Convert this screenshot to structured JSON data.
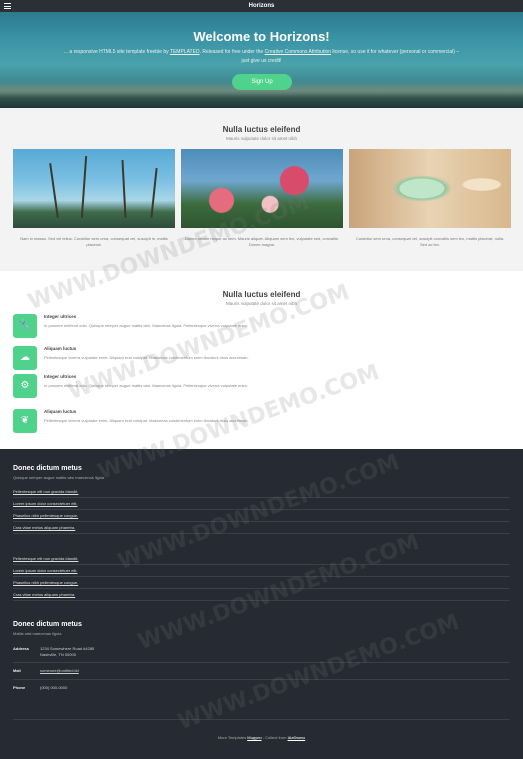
{
  "window": {
    "title": "Horizons"
  },
  "hero": {
    "heading": "Welcome to Horizons!",
    "text_a": "... a responsive HTML5 site template freebie by ",
    "link_templated": "TEMPLATED",
    "text_b": ". Released for free under the ",
    "link_license": "Creative Commons Attribution",
    "text_c": " license, so use it for whatever (personal or commercial) – just give us credit!",
    "signup_label": "Sign Up"
  },
  "section1": {
    "title": "Nulla luctus eleifend",
    "subtitle": "Mauris vulputate dolor sit amet nibh",
    "cards": [
      {
        "image": "palm-trees-photo",
        "text": "Nam in massa. Sed vel tellus. Curabitur sem urna, consequat vel, suscipit in, mattis placerat."
      },
      {
        "image": "pink-flowers-photo",
        "text": "Donec ornare neque ac sem. Mauris aliquet. Aliquam sem leo, vulputate sed, convallis. Donec magna."
      },
      {
        "image": "glass-jar-photo",
        "text": "Curabitur sem urna, consequat vel, suscipit convallis sem leo, mattis placerat, nulla. Sed ac leo."
      }
    ]
  },
  "section2": {
    "title": "Nulla luctus eleifend",
    "subtitle": "Mauris vulputate dolor sit amet nibh",
    "features": [
      {
        "icon": "wrench-icon",
        "glyph": "🔧",
        "title": "Integer ultrices",
        "text": "In posuere eleifend odio. Quisque semper augue mattis wisi. Maecenas ligula. Pellentesque viverra vulputate enim."
      },
      {
        "icon": "cloud-icon",
        "glyph": "☁",
        "title": "Aliquam luctus",
        "text": "Pellentesque viverra vulputate enim. Aliquam erat volutpat. Maecenas condimentum enim tincidunt risus accumsan."
      },
      {
        "icon": "gears-icon",
        "glyph": "⚙",
        "title": "Integer ultrices",
        "text": "In posuere eleifend odio. Quisque semper augue mattis wisi. Maecenas ligula. Pellentesque viverra vulputate enim."
      },
      {
        "icon": "leaf-icon",
        "glyph": "❦",
        "title": "Aliquam luctus",
        "text": "Pellentesque viverra vulputate enim. Aliquam erat volutpat. Maecenas condimentum enim tincidunt risus accumsan."
      }
    ]
  },
  "footer": {
    "links_title": "Donec dictum metus",
    "links_subtitle": "Quisque semper augue mattis wisi maecenas ligula",
    "links_group_1": [
      "Pellentesque elit non gravida blandit.",
      "Lorem ipsum dolor consectetuer elit.",
      "Phasellus nibh pellentesque congue.",
      "Cras vitae metus aliquam pharetra."
    ],
    "links_group_2": [
      "Pellentesque elit non gravida blandit.",
      "Lorem ipsum dolor consectetuer elit.",
      "Phasellus nibh pellentesque congue.",
      "Cras vitae metus aliquam pharetra."
    ],
    "contact_title": "Donec dictum metus",
    "contact_subtitle": "Mattis wisi maecenas ligula",
    "address_label": "Address",
    "address_line1": "1234 Somewhere Road #4285",
    "address_line2": "Nashville, TN 00000",
    "mail_label": "Mail",
    "mail_value": "someone@untitled.tld",
    "phone_label": "Phone",
    "phone_value": "(000) 000-0000",
    "copyright_prefix": "More Templates ",
    "copyright_link1": "Модули",
    "copyright_mid": " - Collect from ",
    "copyright_link2": "Шаблоны"
  },
  "watermark": "WWW.DOWNDEMO.COM",
  "colors": {
    "accent": "#4fd28b",
    "footer_bg": "#262a33",
    "topbar_bg": "#2b2f36"
  }
}
